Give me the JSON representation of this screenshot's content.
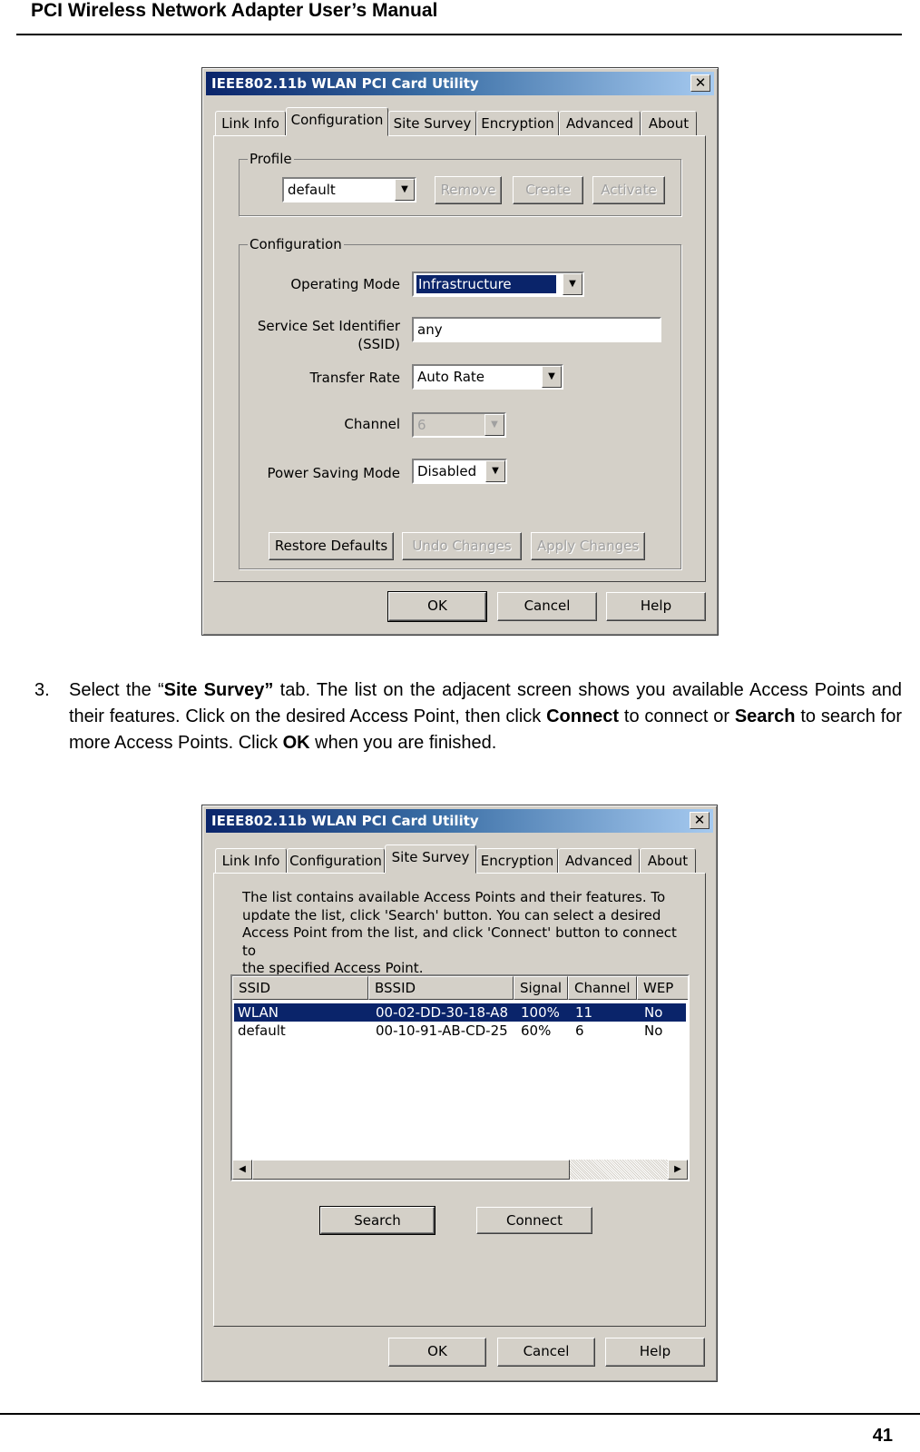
{
  "page": {
    "header": "PCI Wireless Network Adapter User’s Manual",
    "page_number": "41"
  },
  "step": {
    "number": "3.",
    "t1": "Select the “",
    "b1": "Site Survey”",
    "t2": " tab. The list on the adjacent screen shows you available Access Points and their features. Click on the desired Access Point, then click ",
    "b2": "Connect",
    "t3": " to connect or ",
    "b3": "Search",
    "t4": " to search for more Access Points. Click ",
    "b4": "OK",
    "t5": " when you are finished."
  },
  "window1": {
    "title": "IEEE802.11b WLAN PCI Card Utility",
    "close": "✕",
    "tabs": [
      "Link Info",
      "Configuration",
      "Site Survey",
      "Encryption",
      "Advanced",
      "About"
    ],
    "active_tab": "Configuration",
    "profile": {
      "label": "Profile",
      "selected": "default",
      "buttons": [
        "Remove",
        "Create",
        "Activate"
      ]
    },
    "configuration": {
      "label": "Configuration",
      "operating_mode_label": "Operating Mode",
      "operating_mode_value": "Infrastructure",
      "ssid_label_1": "Service Set Identifier",
      "ssid_label_2": "(SSID)",
      "ssid_value": "any",
      "transfer_rate_label": "Transfer Rate",
      "transfer_rate_value": "Auto Rate",
      "channel_label": "Channel",
      "channel_value": "6",
      "power_saving_label": "Power Saving Mode",
      "power_saving_value": "Disabled",
      "restore_button": "Restore Defaults",
      "undo_button": "Undo Changes",
      "apply_button": "Apply Changes"
    },
    "footer_buttons": [
      "OK",
      "Cancel",
      "Help"
    ]
  },
  "window2": {
    "title": "IEEE802.11b WLAN PCI Card Utility",
    "close": "✕",
    "tabs": [
      "Link Info",
      "Configuration",
      "Site Survey",
      "Encryption",
      "Advanced",
      "About"
    ],
    "active_tab": "Site Survey",
    "description": [
      "The list contains available Access Points and their features. To",
      "update the list, click 'Search' button. You can select a desired",
      "Access Point from the list, and click 'Connect' button to connect to",
      "the specified Access Point."
    ],
    "columns": [
      "SSID",
      "BSSID",
      "Signal",
      "Channel",
      "WEP"
    ],
    "rows": [
      {
        "ssid": "WLAN",
        "bssid": "00-02-DD-30-18-A8",
        "signal": "100%",
        "channel": "11",
        "wep": "No"
      },
      {
        "ssid": "default",
        "bssid": "00-10-91-AB-CD-25",
        "signal": "60%",
        "channel": "6",
        "wep": "No"
      }
    ],
    "search_button": "Search",
    "connect_button": "Connect",
    "footer_buttons": [
      "OK",
      "Cancel",
      "Help"
    ]
  },
  "icons": {
    "dropdown_arrow": "▼",
    "scroll_left": "◀",
    "scroll_right": "▶"
  }
}
